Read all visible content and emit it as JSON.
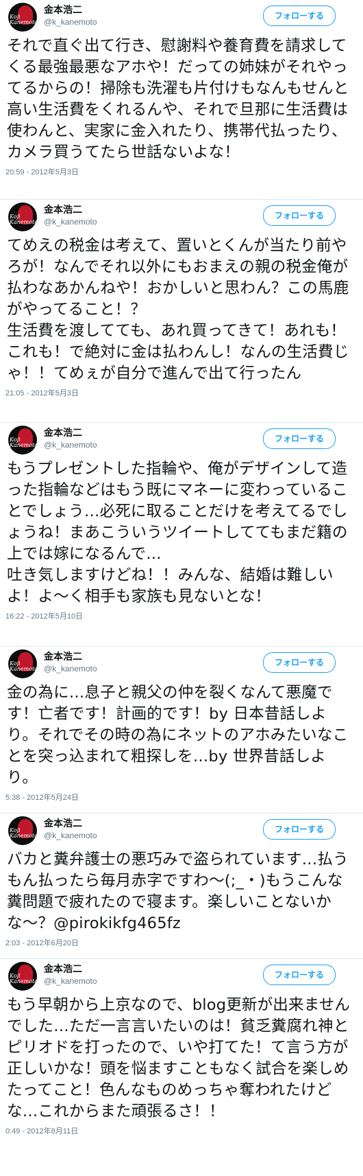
{
  "follow_label": "フォローする",
  "tweets": [
    {
      "name": "金本浩二",
      "handle": "@k_kanemoto",
      "text": "それで直ぐ出て行き、慰謝料や養育費を請求してくる最強最悪なアホや！だっての姉妹がそれやってるからの！掃除も洗濯も片付けもなんもせんと高い生活費をくれるんや、それで旦那に生活費は使わんと、実家に金入れたり、携帯代払ったり、カメラ買うてたら世話ないよな！",
      "time": "20:59 - 2012年5月3日"
    },
    {
      "name": "金本浩二",
      "handle": "@k_kanemoto",
      "text": "てめえの税金は考えて、置いとくんが当たり前やろが！なんでそれ以外にもおまえの親の税金俺が払わなあかんねや！おかしいと思わん？この馬鹿がやってること！？\n生活費を渡してても、あれ買ってきて！あれも！これも！で絶対に金は払わんし！なんの生活費じゃ！！てめぇが自分で進んで出て行ったん",
      "time": "21:05 - 2012年5月3日"
    },
    {
      "name": "金本浩二",
      "handle": "@k_kanemoto",
      "text": "もうプレゼントした指輪や、俺がデザインして造った指輪などはもう既にマネーに変わっていることでしょう…必死に取ることだけを考えてるでしょうね！まあこういうツイートしててもまだ籍の上では嫁になるんで…\n吐き気しますけどね！！みんな、結婚は難しいよ！よ～く相手も家族も見ないとな！",
      "time": "16:22 - 2012年5月10日"
    },
    {
      "name": "金本浩二",
      "handle": "@k_kanemoto",
      "text": "金の為に…息子と親父の仲を裂くなんて悪魔です！亡者です！計画的です！by 日本昔話しより。それでその時の為にネットのアホみたいなことを突っ込まれて粗探しを…by 世界昔話しより。",
      "time": "5:38 - 2012年5月24日"
    },
    {
      "name": "金本浩二",
      "handle": "@k_kanemoto",
      "text": "バカと糞弁護士の悪巧みで盗られています…払うもん払ったら毎月赤字ですわ〜(;_・)もうこんな糞問題で疲れたので寝ます。楽しいことないかな〜？@pirokikfg465fz",
      "time": "2:03 - 2012年6月20日"
    },
    {
      "name": "金本浩二",
      "handle": "@k_kanemoto",
      "text": "もう早朝から上京なので、blog更新が出来ませんでした…ただ一言言いたいのは！貧乏糞腐れ神とピリオドを打ったので、いや打てた！て言う方が正しいかな！頭を悩ますこともなく試合を楽しめたってこと！色んなものめっちゃ奪われたけどな…これからまた頑張るさ！！",
      "time": "0:49 - 2012年8月11日"
    }
  ]
}
